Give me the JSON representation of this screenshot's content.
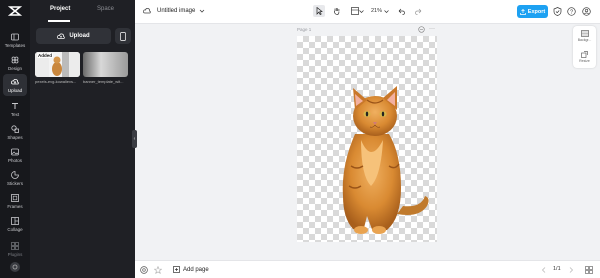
{
  "rail": {
    "items": [
      {
        "label": "Templates",
        "icon": "templates-icon"
      },
      {
        "label": "Design",
        "icon": "design-icon"
      },
      {
        "label": "Upload",
        "icon": "upload-icon"
      },
      {
        "label": "Text",
        "icon": "text-icon"
      },
      {
        "label": "Shapes",
        "icon": "shapes-icon"
      },
      {
        "label": "Photos",
        "icon": "photos-icon"
      },
      {
        "label": "Stickers",
        "icon": "stickers-icon"
      },
      {
        "label": "Frames",
        "icon": "frames-icon"
      },
      {
        "label": "Collage",
        "icon": "collage-icon"
      },
      {
        "label": "Plugins",
        "icon": "plugins-icon"
      }
    ]
  },
  "panel": {
    "tabs": [
      {
        "label": "Project"
      },
      {
        "label": "Space"
      }
    ],
    "upload_label": "Upload",
    "assets": [
      {
        "name": "pexels-evg-kowalievs...",
        "badge": "Added"
      },
      {
        "name": "banner_template_wit..."
      }
    ]
  },
  "topbar": {
    "doc_title": "Untitled image",
    "zoom": "21%",
    "export_label": "Export"
  },
  "canvas": {
    "page_label": "Page 1"
  },
  "right_panel": {
    "items": [
      {
        "label": "Backgr..."
      },
      {
        "label": "Resize"
      }
    ]
  },
  "bottombar": {
    "add_page_label": "Add page",
    "page_count": "1/1"
  },
  "colors": {
    "accent": "#1da1f2",
    "rail_bg": "#17181c",
    "panel_bg": "#1f2025",
    "canvas_bg": "#f1f2f4"
  }
}
